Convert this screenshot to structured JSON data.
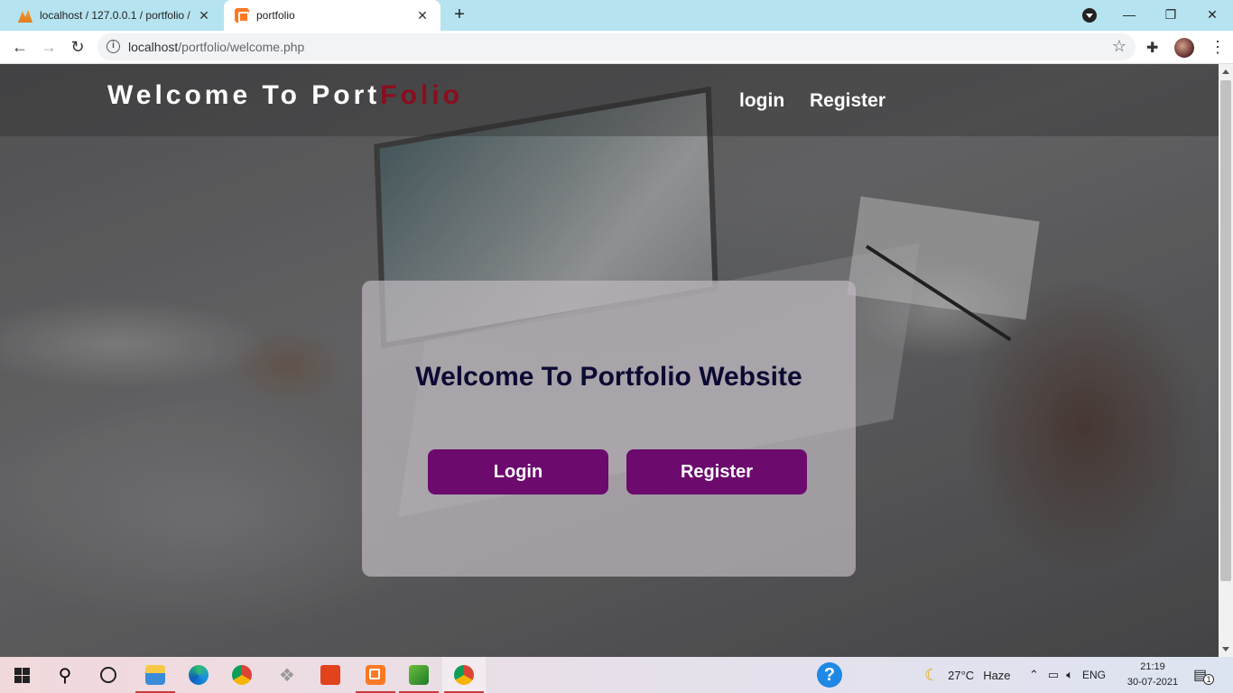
{
  "browser": {
    "tabs": [
      {
        "title": "localhost / 127.0.0.1 / portfolio /",
        "icon": "phpmyadmin-icon",
        "active": false
      },
      {
        "title": "portfolio",
        "icon": "xampp-icon",
        "active": true
      }
    ],
    "url_host": "localhost",
    "url_path": "/portfolio/welcome.php"
  },
  "site": {
    "logo_main": "Welcome To Port",
    "logo_accent": "Folio",
    "nav": {
      "login": "login",
      "register": "Register"
    },
    "card": {
      "heading": "Welcome To Portfolio Website",
      "login_button": "Login",
      "register_button": "Register"
    },
    "colors": {
      "accent_red": "#8b0d1e",
      "button_purple": "#6c0a6e",
      "heading_navy": "#0c0a33"
    }
  },
  "taskbar": {
    "weather_temp": "27°C",
    "weather_text": "Haze",
    "language": "ENG",
    "time": "21:19",
    "date": "30-07-2021",
    "notification_count": "1"
  }
}
